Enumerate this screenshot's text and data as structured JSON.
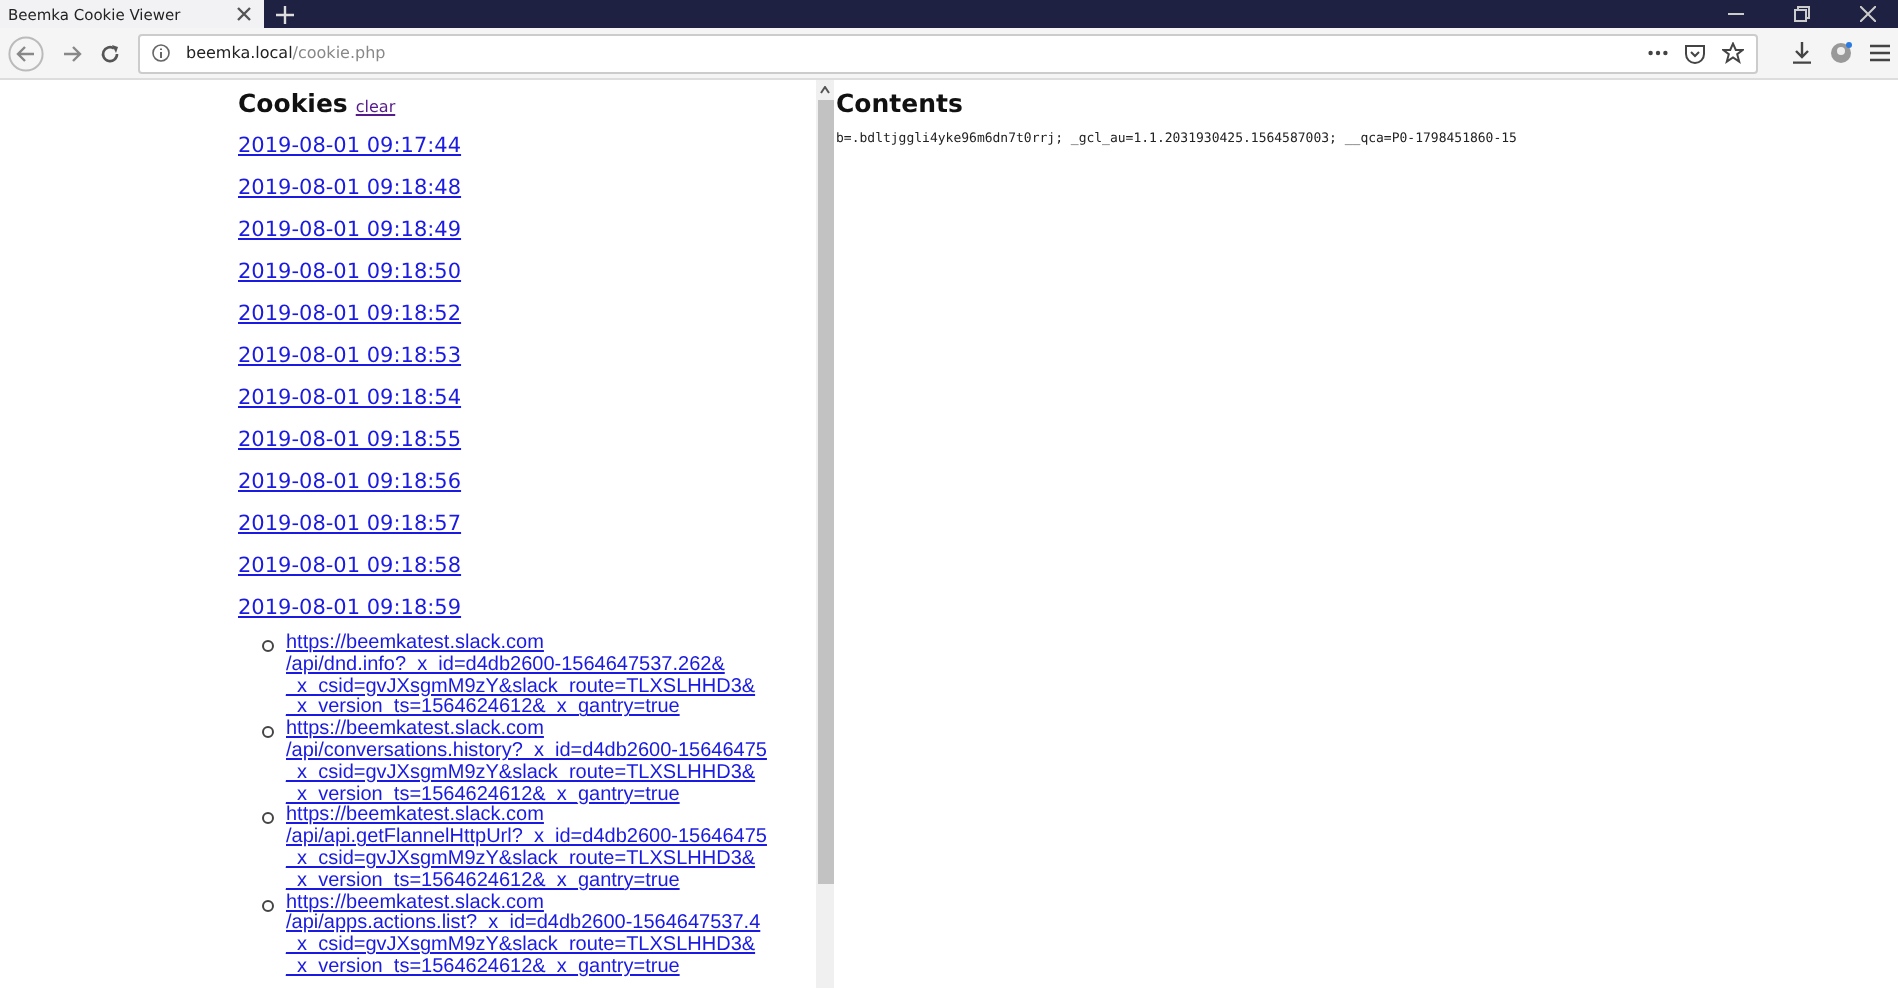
{
  "tabs": [
    {
      "label": "Beemka Cookie Viewer",
      "selected": true
    }
  ],
  "address_bar": {
    "host": "beemka.local",
    "path": "/cookie.php"
  },
  "cookies": {
    "title": "Cookies",
    "clear_link": "clear",
    "dates": [
      "2019-08-01 09:17:44",
      "2019-08-01 09:18:48",
      "2019-08-01 09:18:49",
      "2019-08-01 09:18:50",
      "2019-08-01 09:18:52",
      "2019-08-01 09:18:53",
      "2019-08-01 09:18:54",
      "2019-08-01 09:18:55",
      "2019-08-01 09:18:56",
      "2019-08-01 09:18:57",
      "2019-08-01 09:18:58",
      "2019-08-01 09:18:59"
    ],
    "urls": [
      {
        "lines": [
          "https://beemkatest.slack.com",
          "/api/dnd.info?_x_id=d4db2600-1564647537.262&",
          "_x_csid=gvJXsgmM9zY&slack_route=TLXSLHHD3&",
          "_x_version_ts=1564624612&_x_gantry=true"
        ]
      },
      {
        "lines": [
          "https://beemkatest.slack.com",
          "/api/conversations.history?_x_id=d4db2600-15646475",
          "_x_csid=gvJXsgmM9zY&slack_route=TLXSLHHD3&",
          "_x_version_ts=1564624612&_x_gantry=true"
        ]
      },
      {
        "lines": [
          "https://beemkatest.slack.com",
          "/api/api.getFlannelHttpUrl?_x_id=d4db2600-15646475",
          "_x_csid=gvJXsgmM9zY&slack_route=TLXSLHHD3&",
          "_x_version_ts=1564624612&_x_gantry=true"
        ]
      },
      {
        "lines": [
          "https://beemkatest.slack.com",
          "/api/apps.actions.list?_x_id=d4db2600-1564647537.4",
          "_x_csid=gvJXsgmM9zY&slack_route=TLXSLHHD3&",
          "_x_version_ts=1564624612&_x_gantry=true"
        ]
      }
    ]
  },
  "contents": {
    "title": "Contents",
    "text": "b=.bdltjggli4yke96m6dn7t0rrj; _gcl_au=1.1.2031930425.1564587003; __qca=P0-1798451860-15"
  }
}
